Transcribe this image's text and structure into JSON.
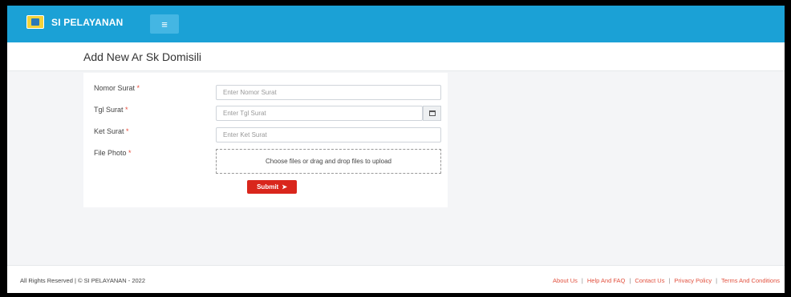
{
  "header": {
    "app_title": "SI PELAYANAN",
    "logo_icon": "logo-emblem",
    "menu_icon": "hamburger-icon",
    "menu_glyph": "≡"
  },
  "page": {
    "title": "Add New Ar Sk Domisili"
  },
  "form": {
    "fields": [
      {
        "label": "Nomor Surat",
        "required_mark": "*",
        "placeholder": "Enter Nomor Surat"
      },
      {
        "label": "Tgl Surat",
        "required_mark": "*",
        "placeholder": "Enter Tgl Surat"
      },
      {
        "label": "Ket Surat",
        "required_mark": "*",
        "placeholder": "Enter Ket Surat"
      },
      {
        "label": "File Photo",
        "required_mark": "*"
      }
    ],
    "upload_text": "Choose files or drag and drop files to upload",
    "submit_label": "Submit",
    "submit_glyph": "➤"
  },
  "footer": {
    "copyright": "All Rights Reserved | © SI PELAYANAN - 2022",
    "links": [
      "About Us",
      "Help And FAQ",
      "Contact Us",
      "Privacy Policy",
      "Terms And Conditions"
    ],
    "separator": "|"
  },
  "colors": {
    "topbar": "#1ba1d6",
    "submit": "#d9261c",
    "required": "#e74c3c",
    "footer_link": "#e2513f"
  }
}
